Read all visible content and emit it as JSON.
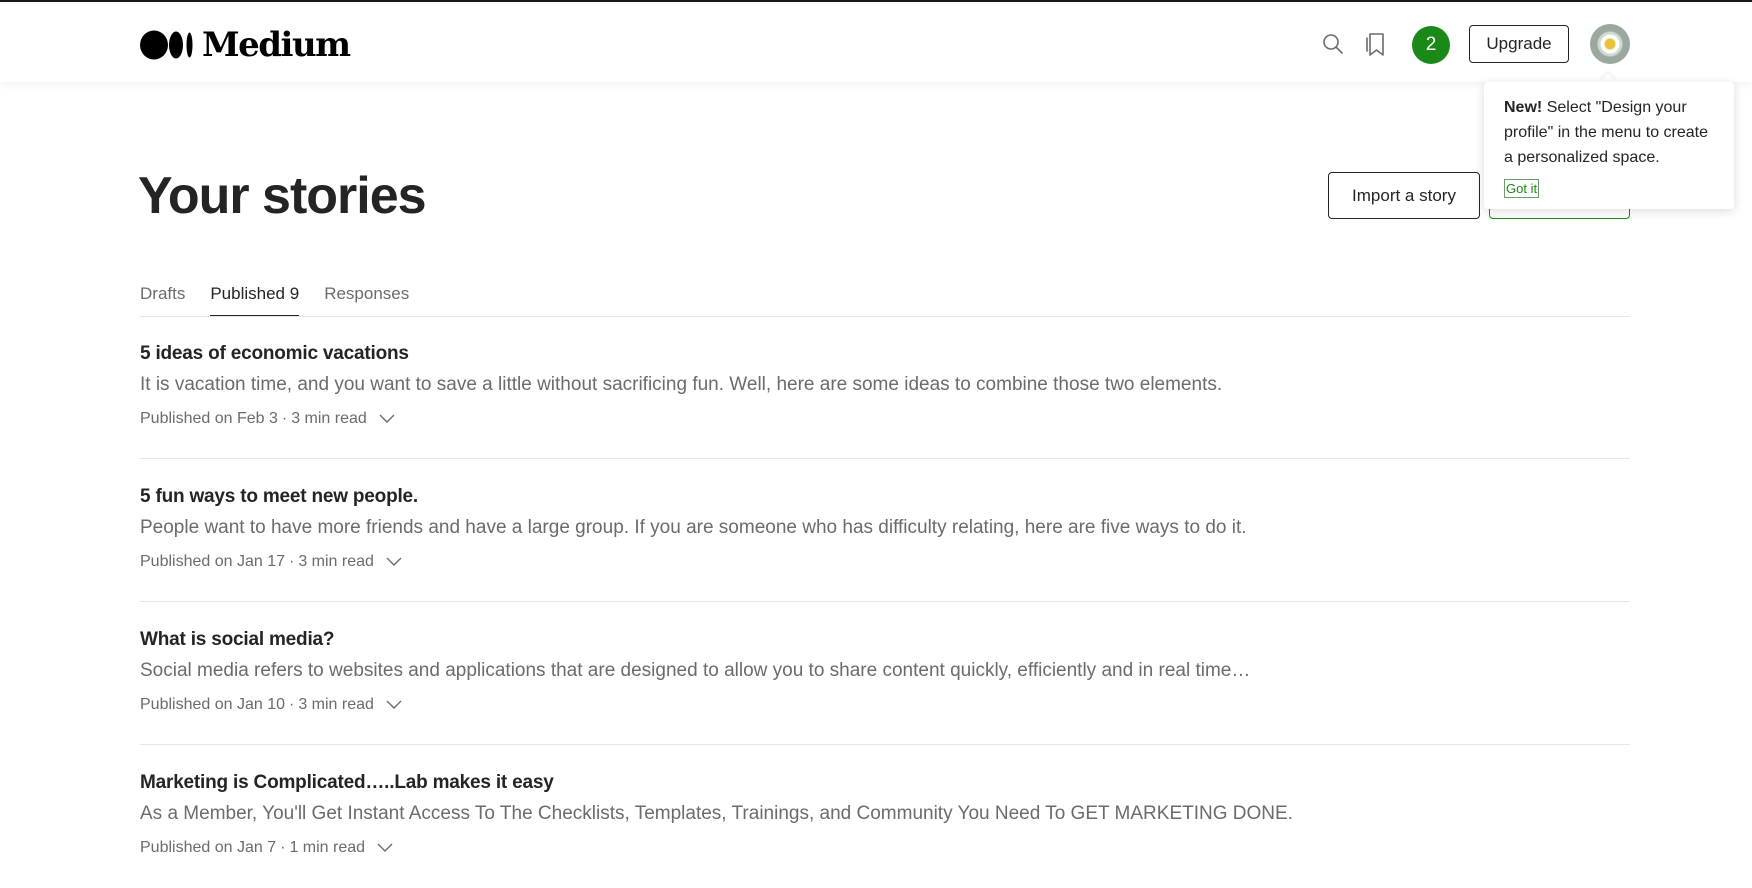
{
  "header": {
    "logo_text": "Medium",
    "notification_count": "2",
    "upgrade_label": "Upgrade",
    "icons": {
      "search": "search-icon",
      "bookmarks": "bookmarks-icon",
      "avatar": "daisy-avatar"
    }
  },
  "tooltip": {
    "bold": "New!",
    "text": "Select \"Design your profile\" in the menu to create a personalized space.",
    "action": "Got it"
  },
  "page": {
    "title": "Your stories",
    "import_label": "Import a story"
  },
  "tabs": [
    {
      "label": "Drafts",
      "active": false
    },
    {
      "label": "Published 9",
      "active": true
    },
    {
      "label": "Responses",
      "active": false
    }
  ],
  "stories": [
    {
      "title": "5 ideas of economic vacations",
      "subtitle": "It is vacation time, and you want to save a little without sacrificing fun. Well, here are some ideas to combine those two elements.",
      "published": "Published on Feb 3",
      "read_time": "3 min read"
    },
    {
      "title": "5 fun ways to meet new people.",
      "subtitle": "People want to have more friends and have a large group. If you are someone who has difficulty relating, here are five ways to do it.",
      "published": "Published on Jan 17",
      "read_time": "3 min read"
    },
    {
      "title": "What is social media?",
      "subtitle": "Social media refers to websites and applications that are designed to allow you to share content quickly, efficiently and in real time…",
      "published": "Published on Jan 10",
      "read_time": "3 min read"
    },
    {
      "title": "Marketing is Complicated…..Lab makes it easy",
      "subtitle": "As a Member, You'll Get Instant Access To The Checklists, Templates, Trainings, and Community You Need To GET MARKETING DONE.",
      "published": "Published on Jan 7",
      "read_time": "1 min read"
    }
  ],
  "colors": {
    "accent_green": "#1a8917",
    "text_primary": "#242424",
    "text_secondary": "#6b6b6b",
    "divider": "#e6e6e6"
  }
}
